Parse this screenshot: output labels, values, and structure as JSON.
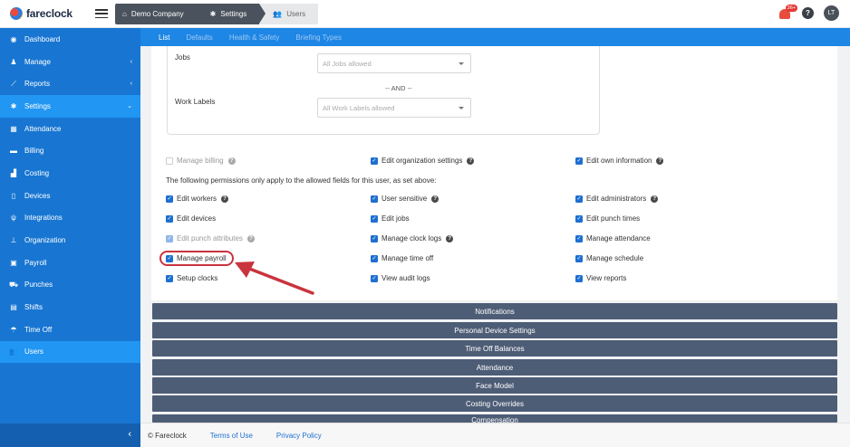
{
  "app": {
    "name": "fareclock"
  },
  "breadcrumbs": [
    {
      "label": "Demo Company",
      "icon": "home-icon"
    },
    {
      "label": "Settings",
      "icon": "gear-icon"
    },
    {
      "label": "Users",
      "icon": "users-icon"
    }
  ],
  "header": {
    "notification_badge": "36+",
    "help": "?",
    "avatar": "LT"
  },
  "sidebar": {
    "items": [
      {
        "label": "Dashboard",
        "icon": "dashboard-icon"
      },
      {
        "label": "Manage",
        "icon": "person-icon",
        "arrow": "‹"
      },
      {
        "label": "Reports",
        "icon": "chart-icon",
        "arrow": "‹"
      },
      {
        "label": "Settings",
        "icon": "gear-icon",
        "arrow": "⌄"
      },
      {
        "label": "Attendance",
        "icon": "calendar-icon"
      },
      {
        "label": "Billing",
        "icon": "card-icon"
      },
      {
        "label": "Costing",
        "icon": "bar-chart-icon"
      },
      {
        "label": "Devices",
        "icon": "tablet-icon"
      },
      {
        "label": "Integrations",
        "icon": "plug-icon"
      },
      {
        "label": "Organization",
        "icon": "org-icon"
      },
      {
        "label": "Payroll",
        "icon": "money-icon"
      },
      {
        "label": "Punches",
        "icon": "punch-icon"
      },
      {
        "label": "Shifts",
        "icon": "shift-icon"
      },
      {
        "label": "Time Off",
        "icon": "umbrella-icon"
      },
      {
        "label": "Users",
        "icon": "users-icon"
      }
    ],
    "collapse": "‹"
  },
  "subnav": {
    "tabs": [
      "List",
      "Defaults",
      "Health & Safety",
      "Briefing Types"
    ]
  },
  "filters": {
    "jobs_label": "Jobs",
    "jobs_placeholder": "All Jobs allowed",
    "and_text": "-- AND --",
    "work_labels_label": "Work Labels",
    "work_labels_placeholder": "All Work Labels allowed"
  },
  "permissions": {
    "manage_billing": "Manage billing",
    "edit_org_settings": "Edit organization settings",
    "edit_own_info": "Edit own information",
    "note": "The following permissions only apply to the allowed fields for this user, as set above:",
    "edit_workers": "Edit workers",
    "user_sensitive": "User sensitive",
    "edit_admins": "Edit administrators",
    "edit_devices": "Edit devices",
    "edit_jobs": "Edit jobs",
    "edit_punch_times": "Edit punch times",
    "edit_punch_attributes": "Edit punch attributes",
    "manage_clock_logs": "Manage clock logs",
    "manage_attendance": "Manage attendance",
    "manage_payroll": "Manage payroll",
    "manage_time_off": "Manage time off",
    "manage_schedule": "Manage schedule",
    "setup_clocks": "Setup clocks",
    "view_audit_logs": "View audit logs",
    "view_reports": "View reports"
  },
  "accordions": [
    "Notifications",
    "Personal Device Settings",
    "Time Off Balances",
    "Attendance",
    "Face Model",
    "Costing Overrides",
    "Compensation"
  ],
  "footer": {
    "copyright": "© Fareclock",
    "terms": "Terms of Use",
    "privacy": "Privacy Policy"
  },
  "colors": {
    "sidebar": "#1876d2",
    "active": "#2196f3",
    "accordion": "#4e5d76",
    "highlight": "#c9343f"
  }
}
